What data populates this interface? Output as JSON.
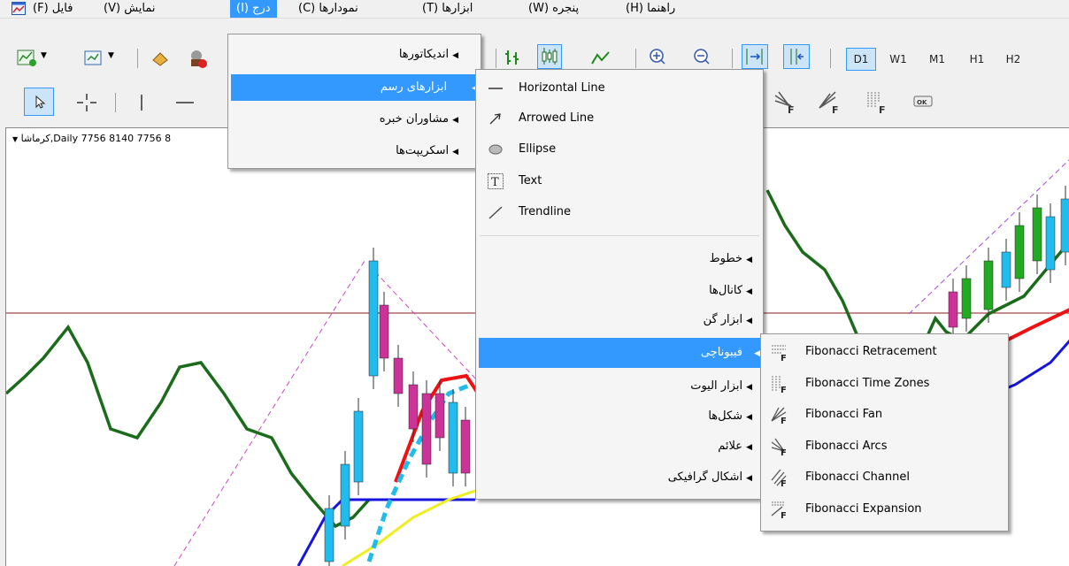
{
  "menubar": {
    "items": [
      {
        "label": "فایل (F)"
      },
      {
        "label": "نمایش (V)"
      },
      {
        "label": "درج (I)"
      },
      {
        "label": "نمودارها (C)"
      },
      {
        "label": "ابزارها (T)"
      },
      {
        "label": "پنجره (W)"
      },
      {
        "label": "راهنما (H)"
      }
    ]
  },
  "timeframes": [
    "D1",
    "W1",
    "M1",
    "H1",
    "H2"
  ],
  "chart": {
    "title": "کرماشا,Daily  7756 8140 7756 8"
  },
  "insert_menu": {
    "items": [
      {
        "label": "اندیکاتورها"
      },
      {
        "label": "ابزارهای رسم"
      },
      {
        "label": "مشاوران خبره"
      },
      {
        "label": "اسکریپت‌ها"
      }
    ]
  },
  "drawing_menu": {
    "tools": [
      {
        "label": "Horizontal Line",
        "icon": "horizontal-line-icon"
      },
      {
        "label": "Arrowed Line",
        "icon": "arrowed-line-icon"
      },
      {
        "label": "Ellipse",
        "icon": "ellipse-icon"
      },
      {
        "label": "Text",
        "icon": "text-icon"
      },
      {
        "label": "Trendline",
        "icon": "trendline-icon"
      }
    ],
    "submenus": [
      {
        "label": "خطوط"
      },
      {
        "label": "کانال‌ها"
      },
      {
        "label": "ابزار گن"
      },
      {
        "label": "فیبوناچی"
      },
      {
        "label": "ابزار الیوت"
      },
      {
        "label": "شکل‌ها"
      },
      {
        "label": "علائم"
      },
      {
        "label": "اشکال گرافیکی"
      }
    ]
  },
  "fibonacci_menu": {
    "items": [
      {
        "label": "Fibonacci Retracement"
      },
      {
        "label": "Fibonacci Time Zones"
      },
      {
        "label": "Fibonacci Fan"
      },
      {
        "label": "Fibonacci Arcs"
      },
      {
        "label": "Fibonacci Channel"
      },
      {
        "label": "Fibonacci Expansion"
      }
    ]
  },
  "colors": {
    "accent": "#3399ff",
    "trend_green": "#1a6b1a",
    "red_line": "#ee1111",
    "blue_line": "#1515dd",
    "cyan_candle": "#22bbee",
    "magenta_candle": "#cc3399"
  }
}
